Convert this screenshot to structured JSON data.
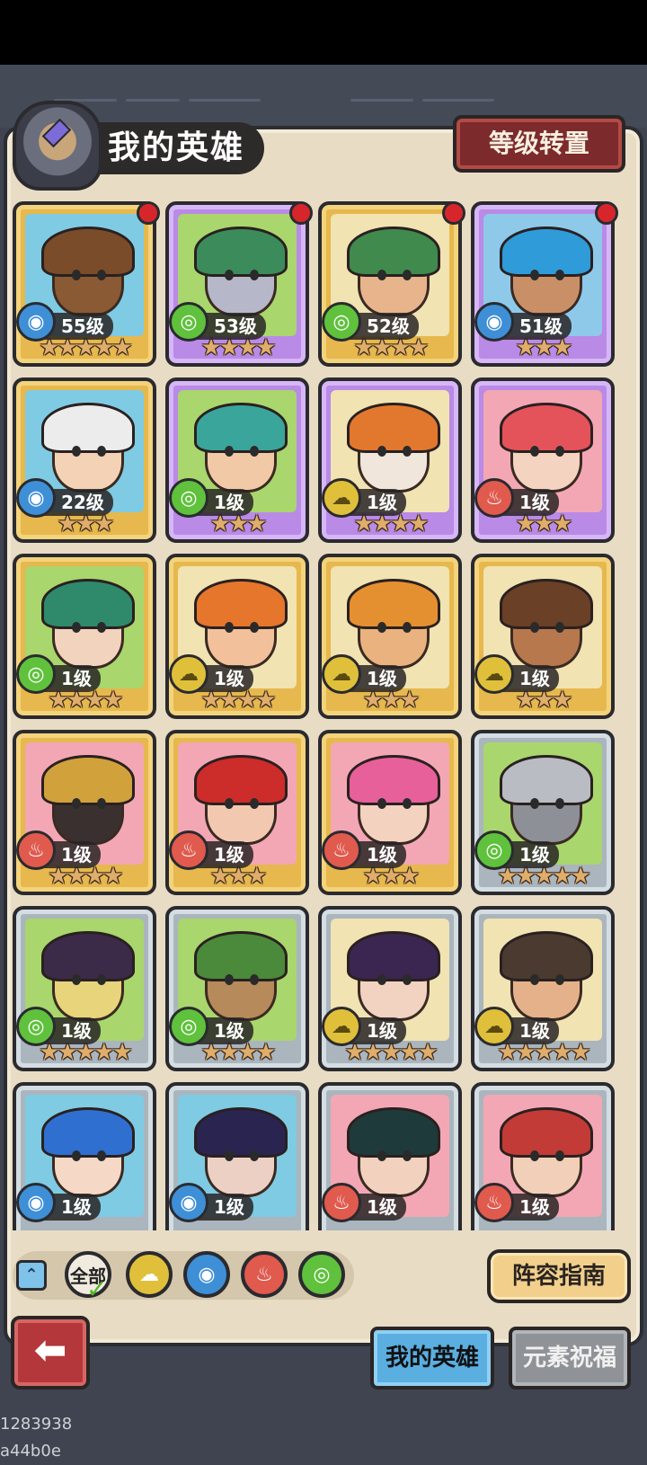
{
  "header": {
    "title": "我的英雄",
    "level_reset_button": "等级转置"
  },
  "heroes": [
    {
      "level": "55级",
      "element": "water",
      "stars": 5,
      "frame": "gold",
      "alert": true,
      "palette": {
        "bg": "#7fcbe3",
        "hair": "#7a4c2a",
        "skin": "#8a5a34"
      }
    },
    {
      "level": "53级",
      "element": "wind",
      "stars": 4,
      "frame": "purple",
      "alert": true,
      "palette": {
        "bg": "#a9d66d",
        "hair": "#3b8c5a",
        "skin": "#b6b7c8"
      }
    },
    {
      "level": "52级",
      "element": "wind",
      "stars": 4,
      "frame": "gold",
      "alert": true,
      "palette": {
        "bg": "#f1e3b2",
        "hair": "#3f8a4c",
        "skin": "#e8b48c"
      }
    },
    {
      "level": "51级",
      "element": "water",
      "stars": 3,
      "frame": "purple",
      "alert": true,
      "palette": {
        "bg": "#8ec9ea",
        "hair": "#2f9bd8",
        "skin": "#c99068"
      }
    },
    {
      "level": "22级",
      "element": "water",
      "stars": 3,
      "frame": "gold",
      "alert": false,
      "palette": {
        "bg": "#7fcbe3",
        "hair": "#ececec",
        "skin": "#f3d2b6"
      }
    },
    {
      "level": "1级",
      "element": "wind",
      "stars": 3,
      "frame": "purple",
      "alert": false,
      "palette": {
        "bg": "#a9d66d",
        "hair": "#3aa59b",
        "skin": "#f2c9a6"
      }
    },
    {
      "level": "1级",
      "element": "earth",
      "stars": 4,
      "frame": "purple",
      "alert": false,
      "palette": {
        "bg": "#f1e3b2",
        "hair": "#e2782e",
        "skin": "#f1e6db"
      }
    },
    {
      "level": "1级",
      "element": "fire",
      "stars": 3,
      "frame": "purple",
      "alert": false,
      "palette": {
        "bg": "#f3a7b4",
        "hair": "#e4535a",
        "skin": "#f4d3c1"
      }
    },
    {
      "level": "1级",
      "element": "wind",
      "stars": 4,
      "frame": "gold",
      "alert": false,
      "palette": {
        "bg": "#a9d66d",
        "hair": "#2e8a6a",
        "skin": "#f2d3bd"
      }
    },
    {
      "level": "1级",
      "element": "earth",
      "stars": 4,
      "frame": "gold",
      "alert": false,
      "palette": {
        "bg": "#f1e3b2",
        "hair": "#e5762b",
        "skin": "#f2c19b"
      }
    },
    {
      "level": "1级",
      "element": "earth",
      "stars": 3,
      "frame": "gold",
      "alert": false,
      "palette": {
        "bg": "#f1e3b2",
        "hair": "#e59030",
        "skin": "#e9b27e"
      }
    },
    {
      "level": "1级",
      "element": "earth",
      "stars": 3,
      "frame": "gold",
      "alert": false,
      "palette": {
        "bg": "#f1e3b2",
        "hair": "#6a4026",
        "skin": "#b7784e"
      }
    },
    {
      "level": "1级",
      "element": "fire",
      "stars": 4,
      "frame": "gold",
      "alert": false,
      "palette": {
        "bg": "#f3a7b4",
        "hair": "#d1a13c",
        "skin": "#3a3030"
      }
    },
    {
      "level": "1级",
      "element": "fire",
      "stars": 3,
      "frame": "gold",
      "alert": false,
      "palette": {
        "bg": "#f3a7b4",
        "hair": "#cc2c2a",
        "skin": "#f2c9b0"
      }
    },
    {
      "level": "1级",
      "element": "fire",
      "stars": 3,
      "frame": "gold",
      "alert": false,
      "palette": {
        "bg": "#f3a7b4",
        "hair": "#e7609a",
        "skin": "#f3d2bf"
      }
    },
    {
      "level": "1级",
      "element": "wind",
      "stars": 5,
      "frame": "silver",
      "alert": false,
      "palette": {
        "bg": "#a9d66d",
        "hair": "#b9bcc2",
        "skin": "#8d9096"
      }
    },
    {
      "level": "1级",
      "element": "wind",
      "stars": 5,
      "frame": "silver",
      "alert": false,
      "palette": {
        "bg": "#a9d66d",
        "hair": "#3b2a48",
        "skin": "#e8d47a"
      }
    },
    {
      "level": "1级",
      "element": "wind",
      "stars": 4,
      "frame": "silver",
      "alert": false,
      "palette": {
        "bg": "#a9d66d",
        "hair": "#4a8a3a",
        "skin": "#b68a5a"
      }
    },
    {
      "level": "1级",
      "element": "earth",
      "stars": 5,
      "frame": "silver",
      "alert": false,
      "palette": {
        "bg": "#f1e3b2",
        "hair": "#3a2650",
        "skin": "#f2d2c0"
      }
    },
    {
      "level": "1级",
      "element": "earth",
      "stars": 5,
      "frame": "silver",
      "alert": false,
      "palette": {
        "bg": "#f1e3b2",
        "hair": "#4a3a30",
        "skin": "#e5b18a"
      }
    },
    {
      "level": "1级",
      "element": "water",
      "stars": 0,
      "frame": "silver",
      "alert": false,
      "palette": {
        "bg": "#7fcbe3",
        "hair": "#2f6fd0",
        "skin": "#f5d8c5"
      }
    },
    {
      "level": "1级",
      "element": "water",
      "stars": 0,
      "frame": "silver",
      "alert": false,
      "palette": {
        "bg": "#7fcbe3",
        "hair": "#2a2450",
        "skin": "#ecd0c4"
      }
    },
    {
      "level": "1级",
      "element": "fire",
      "stars": 0,
      "frame": "silver",
      "alert": false,
      "palette": {
        "bg": "#f3a7b4",
        "hair": "#1f3a3a",
        "skin": "#f2d2be"
      }
    },
    {
      "level": "1级",
      "element": "fire",
      "stars": 0,
      "frame": "silver",
      "alert": false,
      "palette": {
        "bg": "#f3a7b4",
        "hair": "#c23b36",
        "skin": "#f2cfb8"
      }
    }
  ],
  "filters": {
    "all_label": "全部",
    "items": [
      {
        "name": "earth",
        "color": "#e0c03a"
      },
      {
        "name": "water",
        "color": "#3e8fd6"
      },
      {
        "name": "fire",
        "color": "#e05a4e"
      },
      {
        "name": "wind",
        "color": "#5fc13c"
      }
    ]
  },
  "guide_button": "阵容指南",
  "tabs": {
    "my_heroes": "我的英雄",
    "element_blessing": "元素祝福"
  },
  "footer_id": "1283938 a44b0e",
  "element_glyphs": {
    "water": "◉",
    "wind": "◎",
    "fire": "♨",
    "earth": "☁"
  }
}
